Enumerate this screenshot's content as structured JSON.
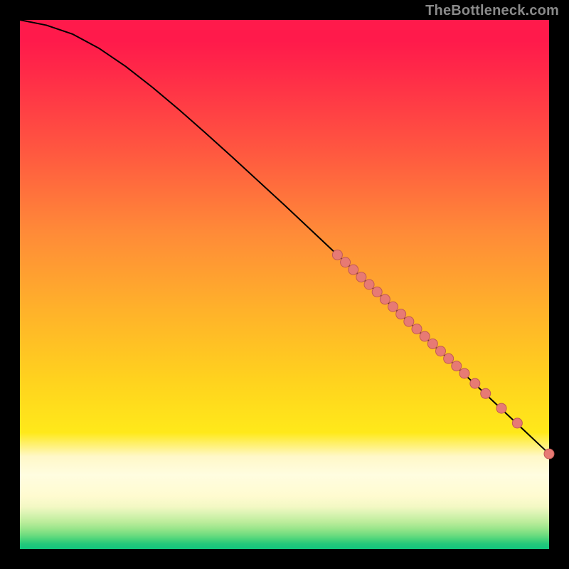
{
  "watermark": "TheBottleneck.com",
  "chart_data": {
    "type": "line",
    "title": "",
    "xlabel": "",
    "ylabel": "",
    "xlim": [
      0,
      100
    ],
    "ylim": [
      0,
      100
    ],
    "grid": false,
    "legend": false,
    "series": [
      {
        "name": "curve",
        "x": [
          0,
          5,
          10,
          15,
          20,
          25,
          30,
          35,
          40,
          45,
          50,
          55,
          60,
          65,
          70,
          75,
          80,
          85,
          90,
          95,
          100
        ],
        "y": [
          100,
          99.0,
          97.3,
          94.6,
          91.2,
          87.3,
          83.1,
          78.7,
          74.2,
          69.6,
          65.0,
          60.3,
          55.6,
          50.9,
          46.2,
          41.5,
          36.8,
          32.1,
          27.4,
          22.7,
          18.0
        ]
      }
    ],
    "scatter_points": {
      "name": "dots",
      "x": [
        60.0,
        61.5,
        63.0,
        64.5,
        66.0,
        67.5,
        69.0,
        70.5,
        72.0,
        73.5,
        75.0,
        76.5,
        78.0,
        79.5,
        81.0,
        82.5,
        84.0,
        86.0,
        88.0,
        91.0,
        94.0,
        100.0
      ],
      "y": [
        55.6,
        54.2,
        52.8,
        51.4,
        50.0,
        48.6,
        47.2,
        45.8,
        44.4,
        43.0,
        41.6,
        40.2,
        38.8,
        37.4,
        36.0,
        34.6,
        33.2,
        31.3,
        29.4,
        26.6,
        23.8,
        18.0
      ]
    },
    "colors": {
      "curve_stroke": "#000000",
      "dot_fill": "#e77a74",
      "dot_stroke": "#c25a55"
    }
  }
}
